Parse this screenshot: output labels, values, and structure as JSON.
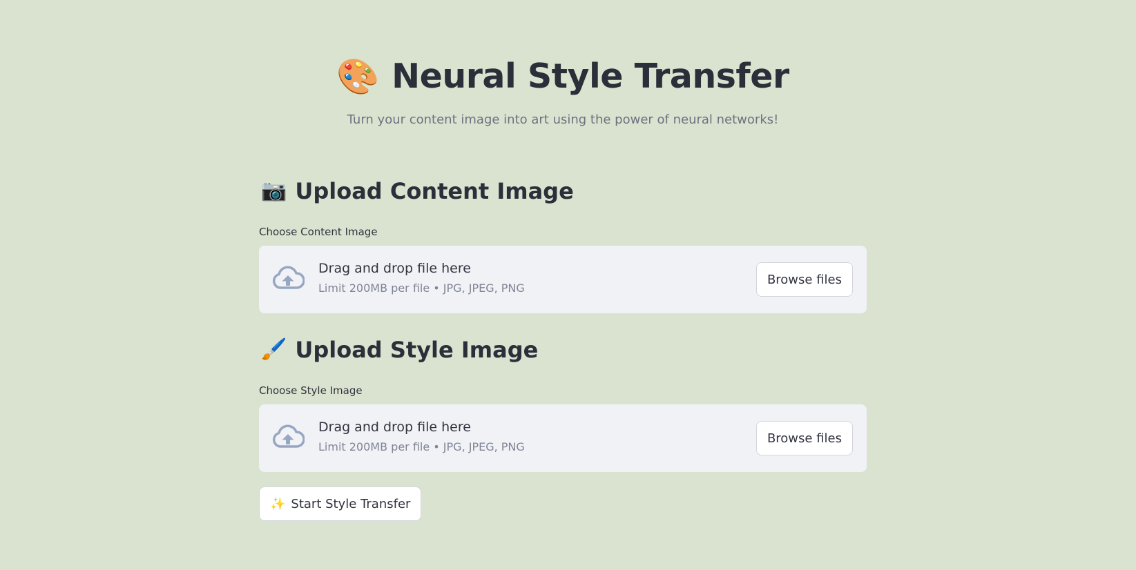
{
  "header": {
    "emoji": "🎨",
    "title": "Neural Style Transfer",
    "subtitle": "Turn your content image into art using the power of neural networks!"
  },
  "content_section": {
    "emoji": "📷",
    "heading": "Upload Content Image",
    "label": "Choose Content Image",
    "dropzone": {
      "main_text": "Drag and drop file here",
      "sub_text": "Limit 200MB per file • JPG, JPEG, PNG",
      "button_label": "Browse files"
    }
  },
  "style_section": {
    "emoji": "🖌️",
    "heading": "Upload Style Image",
    "label": "Choose Style Image",
    "dropzone": {
      "main_text": "Drag and drop file here",
      "sub_text": "Limit 200MB per file • JPG, JPEG, PNG",
      "button_label": "Browse files"
    }
  },
  "actions": {
    "start_emoji": "✨",
    "start_label": "Start Style Transfer"
  },
  "icons": {
    "upload": "cloud-upload-icon"
  },
  "colors": {
    "background": "#dae3cf",
    "dropzone_bg": "#f0f2f6",
    "icon": "#97a6c3",
    "title_text": "#2b2f3a",
    "muted_text": "#808495"
  }
}
